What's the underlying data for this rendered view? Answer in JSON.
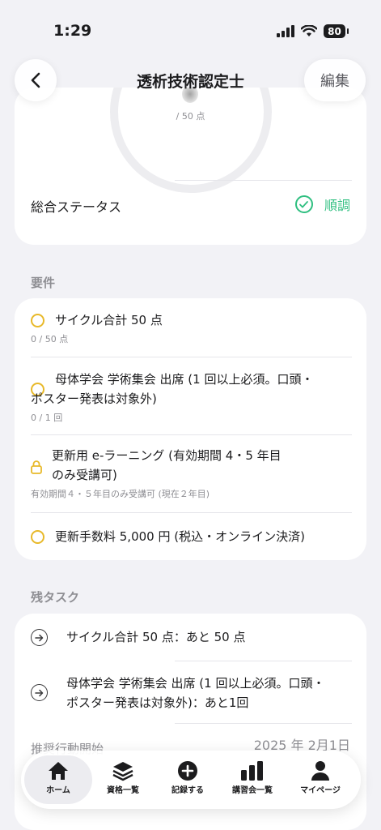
{
  "status_bar": {
    "time": "1:29",
    "battery": "80"
  },
  "header": {
    "title": "透析技術認定士",
    "edit_label": "編集"
  },
  "summary": {
    "score_suffix": "/ 50 点",
    "status_label": "総合ステータス",
    "status_value": "順調",
    "status_color": "#2fbf80"
  },
  "requirements": {
    "section_label": "要件",
    "items": [
      {
        "icon": "circle-outline-icon",
        "title": "サイクル合計 50 点",
        "sub": "0 / 50 点"
      },
      {
        "icon": "circle-outline-icon",
        "title_line1": "母体学会 学術集会 出席 (1 回以上必須。口頭・",
        "title_line2": "ポスター発表は対象外)",
        "sub": "0 / 1 回"
      },
      {
        "icon": "lock-icon",
        "title_line1": "更新用 e-ラーニング (有効期間 4・5 年目",
        "title_line2": "のみ受講可)",
        "sub": "有効期間４・５年目のみ受講可 (現在２年目)"
      },
      {
        "icon": "circle-outline-icon",
        "title": "更新手数料 5,000 円 (税込・オンライン決済)"
      }
    ]
  },
  "tasks": {
    "section_label": "残タスク",
    "items": [
      {
        "icon": "arrow-right-circle-icon",
        "text": "サイクル合計 50 点：あと 50 点"
      },
      {
        "icon": "arrow-right-circle-icon",
        "text_line1": "母体学会 学術集会 出席 (1 回以上必須。口頭・",
        "text_line2": "ポスター発表は対象外)：あと1回"
      }
    ],
    "partial_label": "推奨行動開始",
    "partial_date": "2025 年 2月1日"
  },
  "nav": {
    "items": [
      {
        "label": "ホーム",
        "icon": "home-icon",
        "active": true
      },
      {
        "label": "資格一覧",
        "icon": "layers-icon"
      },
      {
        "label": "記録する",
        "icon": "plus-circle-icon"
      },
      {
        "label": "講習会一覧",
        "icon": "bar-chart-icon"
      },
      {
        "label": "マイページ",
        "icon": "person-icon"
      }
    ]
  },
  "colors": {
    "accent_green": "#2fbf80",
    "pending_yellow": "#e8b92a",
    "background": "#f2f2f6"
  }
}
